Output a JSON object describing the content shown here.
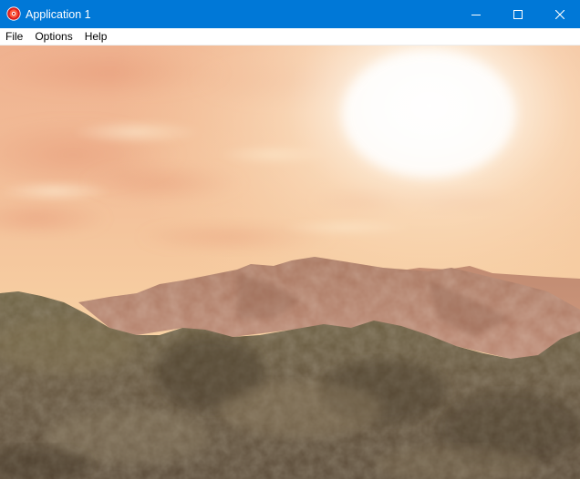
{
  "window": {
    "title": "Application 1",
    "icon": "app-logo-icon",
    "controls": [
      "minimize-icon",
      "maximize-icon",
      "close-icon"
    ],
    "accent_color": "#0078d7"
  },
  "menu": {
    "items": [
      {
        "label": "File"
      },
      {
        "label": "Options"
      },
      {
        "label": "Help"
      }
    ]
  },
  "scene": {
    "description_type": "3d-terrain-render",
    "sky_colors": [
      "#e8a47f",
      "#f6cfa0",
      "#fff6e6"
    ],
    "terrain_colors": [
      "#5a4a36",
      "#7b6a4a",
      "#c08a6c"
    ]
  }
}
